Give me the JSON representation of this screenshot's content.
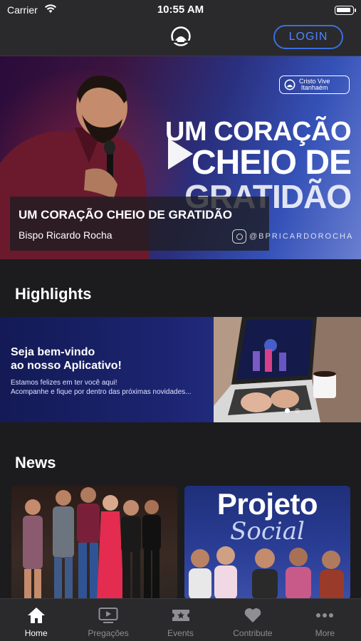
{
  "status_bar": {
    "carrier": "Carrier",
    "time": "10:55 AM"
  },
  "nav": {
    "login_label": "LOGIN",
    "logo_icon": "church-logo-icon"
  },
  "hero": {
    "brand_line1": "Cristo Vive",
    "brand_line2": "Itanhaém",
    "headline_line1": "UM CORAÇÃO",
    "headline_line2": "CHEIO DE",
    "headline_line3": "GRATIDÃO",
    "caption_title": "UM CORAÇÃO CHEIO DE GRATIDÃO",
    "caption_subtitle": "Bispo Ricardo Rocha",
    "instagram_handle": "@BPRICARDOROCHA"
  },
  "highlights": {
    "section_title": "Highlights",
    "banner_title_line1": "Seja bem-vindo",
    "banner_title_line2": "ao nosso Aplicativo!",
    "banner_body_line1": "Estamos felizes em ter você aqui!",
    "banner_body_line2": "Acompanhe e fique por dentro das próximas novidades...",
    "slides_count": 2,
    "active_slide": 1
  },
  "news": {
    "section_title": "News",
    "cards": [
      {
        "image": "group-photo"
      },
      {
        "image_text_line1": "Projeto",
        "image_text_line2": "Social"
      }
    ]
  },
  "tab_bar": {
    "items": [
      {
        "label": "Home",
        "icon": "home-icon",
        "active": true
      },
      {
        "label": "Pregações",
        "icon": "video-icon",
        "active": false
      },
      {
        "label": "Events",
        "icon": "ticket-icon",
        "active": false
      },
      {
        "label": "Contribute",
        "icon": "heart-icon",
        "active": false
      },
      {
        "label": "More",
        "icon": "more-icon",
        "active": false
      }
    ]
  },
  "colors": {
    "accent": "#3b6fe0",
    "background": "#1c1c1e",
    "bars": "#2a2a2c"
  }
}
